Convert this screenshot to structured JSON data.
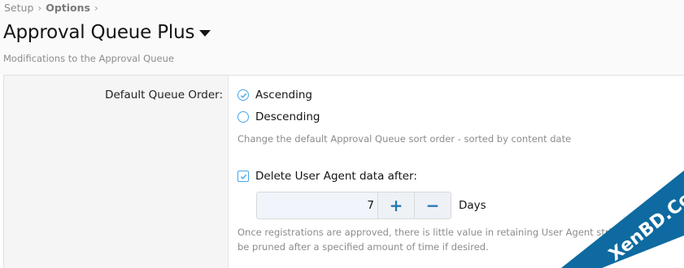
{
  "breadcrumb": {
    "items": [
      "Setup",
      "Options"
    ],
    "separator": "›"
  },
  "header": {
    "title": "Approval Queue Plus",
    "description": "Modifications to the Approval Queue"
  },
  "queue_order": {
    "label": "Default Queue Order:",
    "options": [
      {
        "label": "Ascending",
        "selected": true
      },
      {
        "label": "Descending",
        "selected": false
      }
    ],
    "hint": "Change the default Approval Queue sort order - sorted by content date"
  },
  "user_agent": {
    "checkbox_label": "Delete User Agent data after:",
    "checked": true,
    "value": "7",
    "increment_label": "+",
    "decrement_label": "−",
    "units": "Days",
    "hint_line1": "Once registrations are approved, there is little value in retaining User Agent strings so they can",
    "hint_line2": "be pruned after a specified amount of time if desired."
  },
  "watermark": {
    "text": "XenBD.Com"
  },
  "colors": {
    "accent": "#47a7eb",
    "button_text": "#2577b1",
    "watermark": "#0e6aa0"
  }
}
